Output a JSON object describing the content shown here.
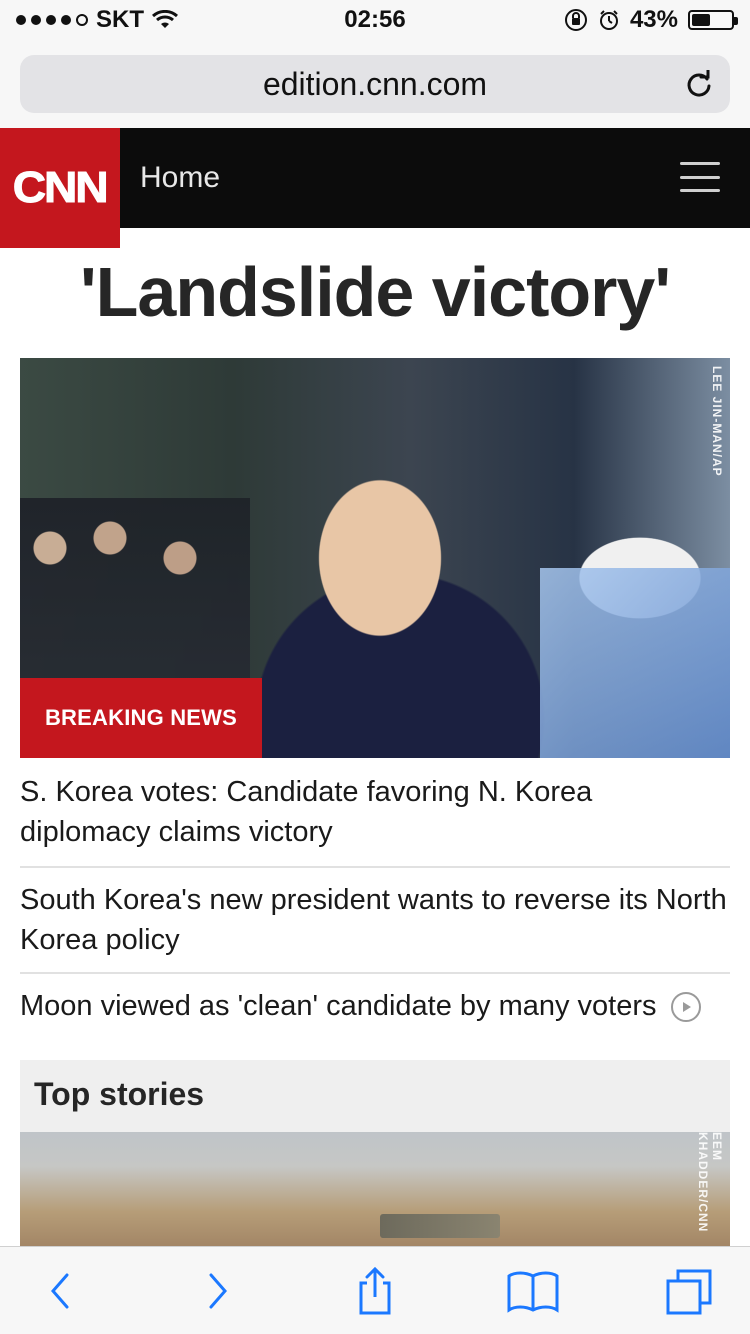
{
  "status_bar": {
    "carrier": "SKT",
    "time": "02:56",
    "battery_percent": "43%",
    "battery_level": 0.43
  },
  "browser": {
    "url": "edition.cnn.com"
  },
  "header": {
    "logo_text": "CNN",
    "nav_label": "Home",
    "accent_color": "#c4171e"
  },
  "main": {
    "headline": "'Landslide victory'",
    "hero": {
      "badge": "BREAKING NEWS",
      "credit": "LEE JIN-MAN/AP"
    },
    "stories": [
      {
        "title": "S. Korea votes: Candidate favoring N. Korea diplomacy claims victory"
      },
      {
        "title": "South Korea's new president wants to reverse its North Korea policy"
      },
      {
        "title": "Moon viewed as 'clean' candidate by many voters",
        "has_video": true
      }
    ]
  },
  "top_stories": {
    "title": "Top stories",
    "credit": "EEM KHADDER/CNN"
  },
  "toolbar": {
    "icons": [
      "back-icon",
      "forward-icon",
      "share-icon",
      "bookmarks-icon",
      "tabs-icon"
    ]
  }
}
